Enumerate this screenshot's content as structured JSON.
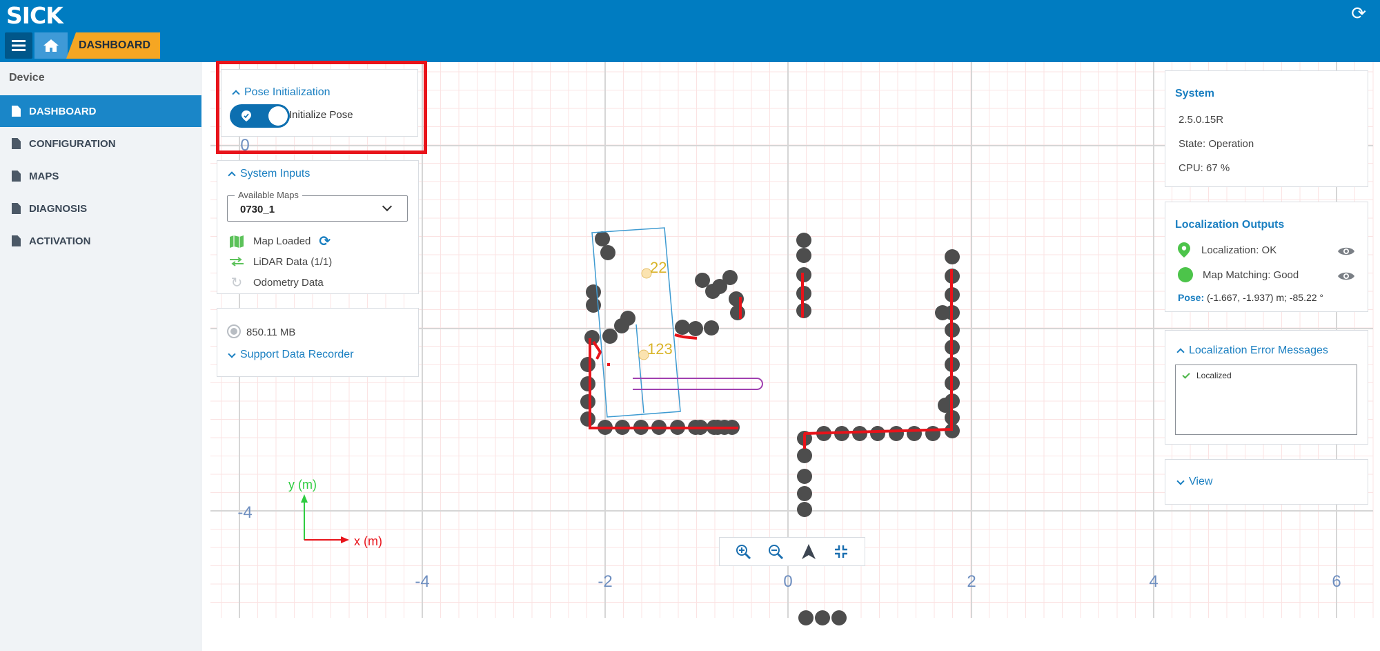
{
  "header": {
    "logo": "SICK",
    "breadcrumb": "DASHBOARD"
  },
  "sidebar": {
    "heading": "Device",
    "items": [
      {
        "label": "DASHBOARD",
        "active": true
      },
      {
        "label": "CONFIGURATION",
        "active": false
      },
      {
        "label": "MAPS",
        "active": false
      },
      {
        "label": "DIAGNOSIS",
        "active": false
      },
      {
        "label": "ACTIVATION",
        "active": false
      }
    ]
  },
  "pose_init": {
    "title": "Pose Initialization",
    "toggle_label": "Initialize Pose",
    "toggle_on": true
  },
  "system_inputs": {
    "title": "System Inputs",
    "available_maps_label": "Available Maps",
    "selected_map": "0730_1",
    "map_loaded": "Map Loaded",
    "lidar": "LiDAR Data (1/1)",
    "odometry": "Odometry Data"
  },
  "storage": {
    "value": "850.11 MB",
    "recorder_label": "Support Data Recorder"
  },
  "system": {
    "title": "System",
    "version": "2.5.0.15R",
    "state": "State: Operation",
    "cpu": "CPU: 67 %"
  },
  "localization": {
    "title": "Localization Outputs",
    "status": "Localization: OK",
    "matching": "Map Matching: Good",
    "pose_label": "Pose:",
    "pose_value": "(-1.667, -1.937) m; -85.22 °"
  },
  "errors": {
    "title": "Localization Error Messages",
    "items": [
      "Localized"
    ]
  },
  "view": {
    "title": "View"
  },
  "map": {
    "x_ticks": [
      "-4",
      "-2",
      "0",
      "2",
      "4",
      "6"
    ],
    "y_ticks": [
      "0",
      "-4"
    ],
    "axis_x_label": "x (m)",
    "axis_y_label": "y (m)",
    "particle_labels": [
      "22",
      "123"
    ]
  },
  "colors": {
    "header": "#007cc1",
    "accent": "#1a7fc1",
    "breadcrumb": "#f5a623",
    "scan": "#e8131a",
    "points": "#4d4d4d"
  }
}
